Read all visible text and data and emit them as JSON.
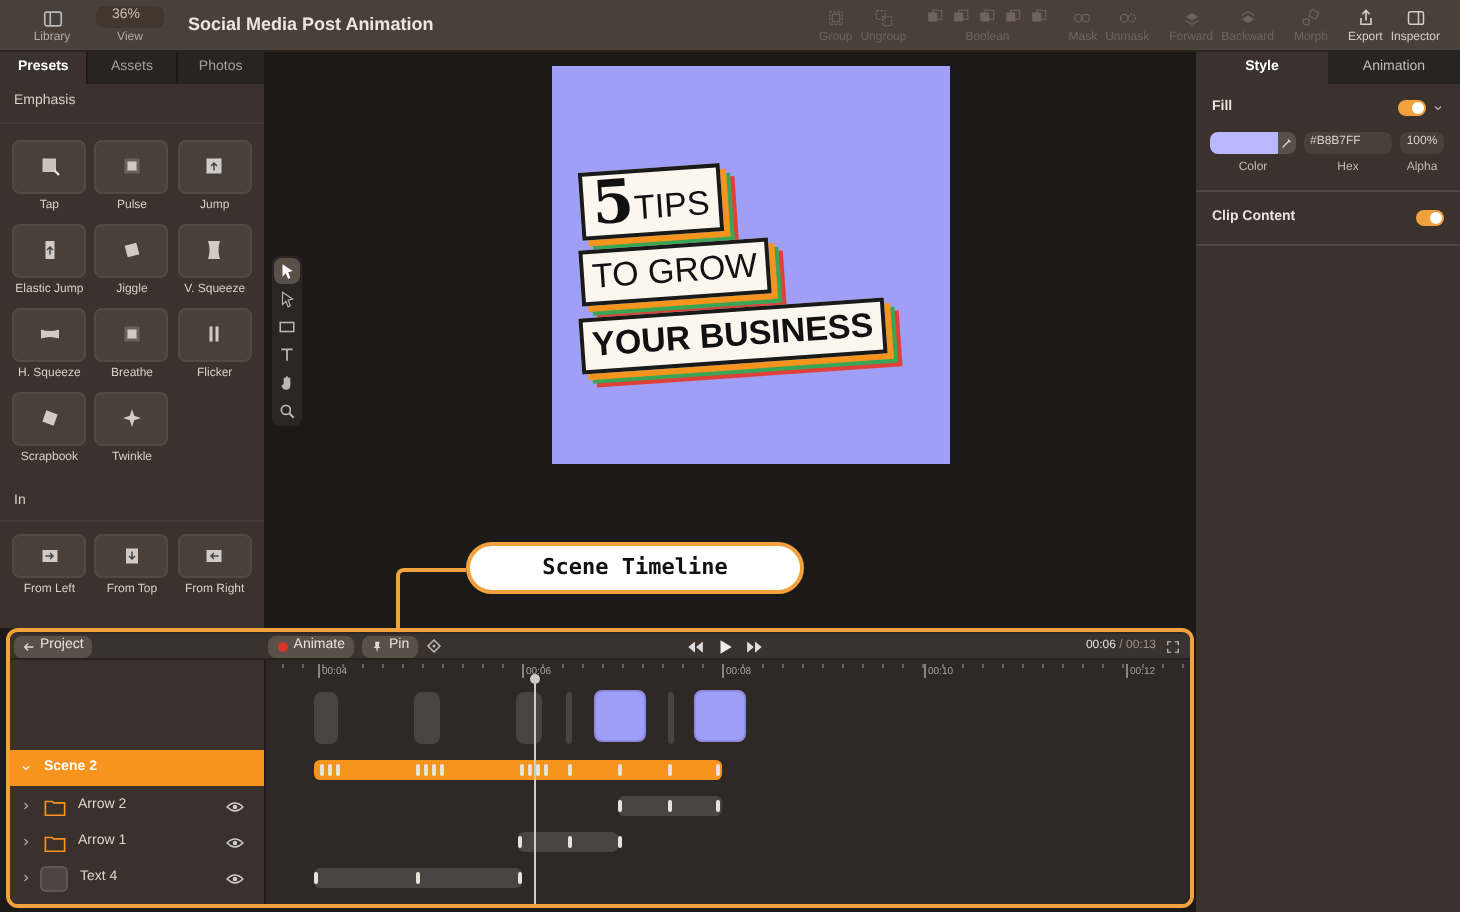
{
  "toolbar": {
    "library": {
      "label": "Library"
    },
    "view": {
      "label": "View",
      "value": "36%"
    },
    "title": "Social Media Post Animation",
    "tools": [
      {
        "kind": "single",
        "label": "Group",
        "disabled": true
      },
      {
        "kind": "single",
        "label": "Ungroup",
        "disabled": true
      },
      {
        "kind": "boolean",
        "label": "Boolean",
        "disabled": true
      },
      {
        "kind": "single",
        "label": "Mask",
        "disabled": true
      },
      {
        "kind": "single",
        "label": "Unmask",
        "disabled": true
      },
      {
        "kind": "single",
        "label": "Forward",
        "disabled": true
      },
      {
        "kind": "single",
        "label": "Backward",
        "disabled": true
      },
      {
        "kind": "single",
        "label": "Morph",
        "disabled": true
      },
      {
        "kind": "single",
        "label": "Export",
        "disabled": false
      },
      {
        "kind": "single",
        "label": "Inspector",
        "disabled": false
      }
    ]
  },
  "library": {
    "tabs": [
      {
        "label": "Presets",
        "selected": true
      },
      {
        "label": "Assets",
        "selected": false
      },
      {
        "label": "Photos",
        "selected": false
      }
    ],
    "sections": [
      {
        "title": "Emphasis",
        "items": [
          "Tap",
          "Pulse",
          "Jump",
          "Elastic Jump",
          "Jiggle",
          "V. Squeeze",
          "H. Squeeze",
          "Breathe",
          "Flicker",
          "Scrapbook",
          "Twinkle"
        ]
      },
      {
        "title": "In",
        "items": [
          "From Left",
          "From Top",
          "From Right"
        ]
      }
    ]
  },
  "canvas": {
    "tools": [
      {
        "selected": true
      },
      {
        "selected": false
      },
      {
        "selected": false
      },
      {
        "selected": false
      },
      {
        "selected": false
      },
      {
        "selected": false
      }
    ],
    "artboard": {
      "lines": [
        {
          "numeral": "5",
          "text": "TIPS"
        },
        {
          "text": "TO GROW"
        },
        {
          "text": "YOUR BUSINESS"
        }
      ]
    },
    "callout": "Scene Timeline"
  },
  "inspector": {
    "tabs": [
      {
        "label": "Style",
        "selected": true
      },
      {
        "label": "Animation",
        "selected": false
      }
    ],
    "fill": {
      "label": "Fill",
      "on": true,
      "color": "#b8b7ff",
      "hex": "#B8B7FF",
      "alpha": "100%",
      "labels": [
        "Color",
        "Hex",
        "Alpha"
      ]
    },
    "clip_content": {
      "label": "Clip Content",
      "on": true
    }
  },
  "timeline": {
    "back": "Project",
    "animate": "Animate",
    "pin": "Pin",
    "current": "00:06",
    "separator": "/",
    "total": "00:13",
    "ruler": [
      "00:04",
      "00:06",
      "00:08",
      "00:10",
      "00:12"
    ],
    "tracks": [
      {
        "kind": "scene",
        "name": "Scene 2",
        "expanded": true,
        "selected": true
      },
      {
        "kind": "folder",
        "name": "Arrow 2",
        "expanded": false,
        "selected": false
      },
      {
        "kind": "folder",
        "name": "Arrow 1",
        "expanded": false,
        "selected": false
      },
      {
        "kind": "layer",
        "name": "Text 4",
        "expanded": false,
        "selected": false
      }
    ]
  }
}
